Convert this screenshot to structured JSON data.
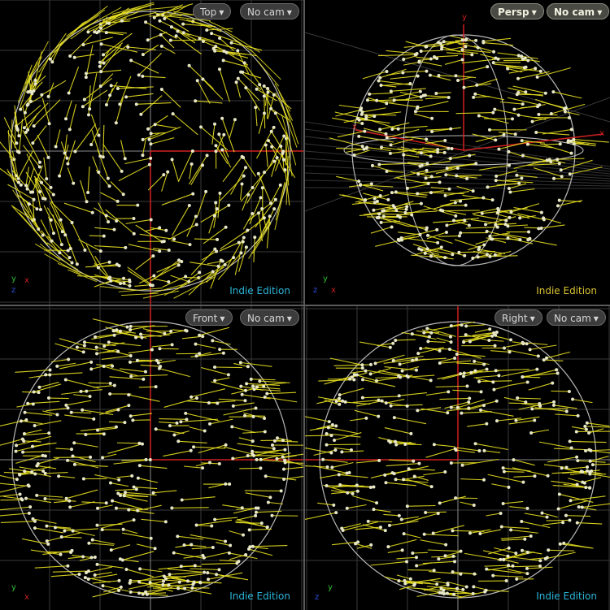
{
  "viewports": {
    "top": {
      "view_label": "Top",
      "camera_label": "No cam",
      "edition_label": "Indie Edition",
      "gizmo": [
        "y",
        "x",
        "z"
      ]
    },
    "persp": {
      "view_label": "Persp",
      "camera_label": "No cam",
      "edition_label": "Indie Edition",
      "gizmo": [
        "y",
        "z",
        "x"
      ],
      "axis_labels": [
        "y",
        "x",
        "x"
      ]
    },
    "front": {
      "view_label": "Front",
      "camera_label": "No cam",
      "edition_label": "Indie Edition",
      "gizmo": [
        "y",
        "x"
      ]
    },
    "right": {
      "view_label": "Right",
      "camera_label": "No cam",
      "edition_label": "Indie Edition",
      "gizmo": [
        "y",
        "z"
      ]
    }
  },
  "colors": {
    "background": "#000000",
    "grid": "#3a3a3a",
    "sphere_wire": "#b8b8b8",
    "hair": "#e8e020",
    "point": "#e8e8c8",
    "axis_x": "#d02020",
    "axis_y": "#30c030",
    "axis_z": "#3050e0",
    "edition_cyan": "#2bb5d8",
    "edition_yellow": "#d9c232"
  },
  "icons": {
    "dropdown": "caret-down-icon"
  }
}
